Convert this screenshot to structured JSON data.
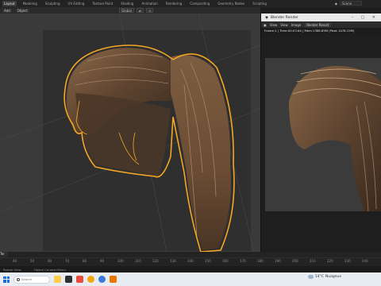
{
  "topbar": {
    "tabs": [
      "Layout",
      "Modeling",
      "Sculpting",
      "UV Editing",
      "Texture Paint",
      "Shading",
      "Animation",
      "Rendering",
      "Compositing",
      "Geometry Nodes",
      "Scripting"
    ],
    "active_tab": "Layout",
    "scene_label": "Scene"
  },
  "viewport": {
    "header_left": [
      "Add",
      "Object"
    ],
    "header_mid": [
      "Global",
      "⇄",
      "⊙"
    ],
    "transport": [
      "|◀",
      "◀◀",
      "◀",
      "▶",
      "▶▶",
      "▶|"
    ]
  },
  "render_window": {
    "title": "Blender Render",
    "toolbar": [
      "View",
      "View",
      "Image"
    ],
    "slot": "Render Result",
    "info": "Frame:1 | Time:00:03.64 | Mem:1386.85M (Peak 1478.15M)"
  },
  "timeline": {
    "start_label": "Ter",
    "frames": [
      "40",
      "50",
      "60",
      "70",
      "80",
      "90",
      "100",
      "110",
      "120",
      "130",
      "140",
      "150",
      "160",
      "170",
      "180",
      "190",
      "200",
      "210",
      "220",
      "230",
      "240",
      "250"
    ],
    "status_left": "Rotate View",
    "status_mid": "Object Context Menu"
  },
  "taskbar": {
    "search_placeholder": "Search",
    "temperature": "14°C",
    "condition": "Nuageux"
  },
  "colors": {
    "outline_orange": "#f5a623",
    "hair_brown": "#7a5a3c"
  }
}
